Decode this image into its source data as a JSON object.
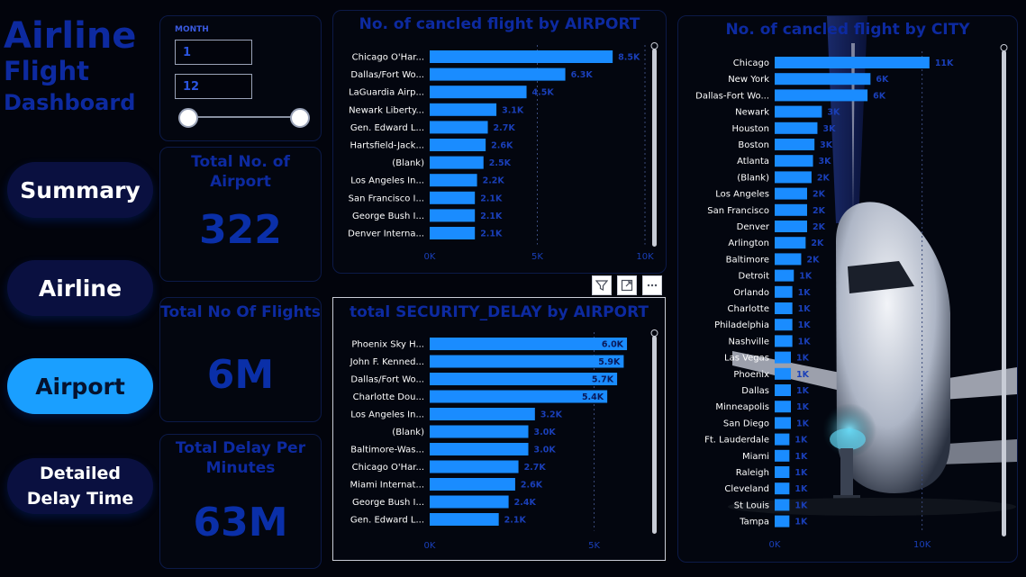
{
  "header": {
    "line1": "Airline",
    "line2": "Flight",
    "line3": "Dashboard"
  },
  "nav": {
    "summary": "Summary",
    "airline": "Airline",
    "airport": "Airport",
    "detailed": "Detailed Delay Time"
  },
  "filter": {
    "label": "MONTH",
    "min_value": "1",
    "max_value": "12"
  },
  "kpis": {
    "airports": {
      "title": "Total No. of Airport",
      "value": "322"
    },
    "flights": {
      "title": "Total No Of Flights",
      "value": "6M"
    },
    "delay": {
      "title": "Total Delay Per Minutes",
      "value": "63M"
    }
  },
  "colors": {
    "bar": "#1a8cff",
    "title": "#0d2aa0",
    "label": "#ffffff",
    "data_label": "#1a3fb8",
    "axis": "#1a3fb8"
  },
  "chart_data": [
    {
      "type": "bar",
      "orientation": "horizontal",
      "title": "No. of cancled flight by AIRPORT",
      "categories": [
        "Chicago O'Har...",
        "Dallas/Fort Wo...",
        "LaGuardia Airp...",
        "Newark Liberty...",
        "Gen. Edward L...",
        "Hartsfield-Jack...",
        "(Blank)",
        "Los Angeles In...",
        "San Francisco I...",
        "George Bush I...",
        "Denver Interna..."
      ],
      "values": [
        8500,
        6300,
        4500,
        3100,
        2700,
        2600,
        2500,
        2200,
        2100,
        2100,
        2100
      ],
      "data_labels": [
        "8.5K",
        "6.3K",
        "4.5K",
        "3.1K",
        "2.7K",
        "2.6K",
        "2.5K",
        "2.2K",
        "2.1K",
        "2.1K",
        "2.1K"
      ],
      "xticks": [
        "0K",
        "5K",
        "10K"
      ],
      "xlim": [
        0,
        10000
      ]
    },
    {
      "type": "bar",
      "orientation": "horizontal",
      "title": "total SECURITY_DELAY by AIRPORT",
      "categories": [
        "Phoenix Sky H...",
        "John F. Kenned...",
        "Dallas/Fort Wo...",
        "Charlotte Dou...",
        "Los Angeles In...",
        "(Blank)",
        "Baltimore-Was...",
        "Chicago O'Har...",
        "Miami Internat...",
        "George Bush I...",
        "Gen. Edward L..."
      ],
      "values": [
        6000,
        5900,
        5700,
        5400,
        3200,
        3000,
        3000,
        2700,
        2600,
        2400,
        2100
      ],
      "data_labels": [
        "6.0K",
        "5.9K",
        "5.7K",
        "5.4K",
        "3.2K",
        "3.0K",
        "3.0K",
        "2.7K",
        "2.6K",
        "2.4K",
        "2.1K"
      ],
      "xticks": [
        "0K",
        "5K"
      ],
      "xlim": [
        0,
        6300
      ]
    },
    {
      "type": "bar",
      "orientation": "horizontal",
      "title": "No. of cancled flight by CITY",
      "categories": [
        "Chicago",
        "New York",
        "Dallas-Fort Wo...",
        "Newark",
        "Houston",
        "Boston",
        "Atlanta",
        "(Blank)",
        "Los Angeles",
        "San Francisco",
        "Denver",
        "Arlington",
        "Baltimore",
        "Detroit",
        "Orlando",
        "Charlotte",
        "Philadelphia",
        "Nashville",
        "Las Vegas",
        "Phoenix",
        "Dallas",
        "Minneapolis",
        "San Diego",
        "Ft. Lauderdale",
        "Miami",
        "Raleigh",
        "Cleveland",
        "St Louis",
        "Tampa"
      ],
      "values": [
        10500,
        6500,
        6300,
        3200,
        2900,
        2700,
        2600,
        2500,
        2200,
        2200,
        2200,
        2100,
        1800,
        1300,
        1200,
        1200,
        1200,
        1200,
        1100,
        1100,
        1100,
        1100,
        1100,
        1000,
        1000,
        1000,
        1000,
        1000,
        1000
      ],
      "data_labels": [
        "11K",
        "6K",
        "6K",
        "3K",
        "3K",
        "3K",
        "3K",
        "2K",
        "2K",
        "2K",
        "2K",
        "2K",
        "2K",
        "1K",
        "1K",
        "1K",
        "1K",
        "1K",
        "1K",
        "1K",
        "1K",
        "1K",
        "1K",
        "1K",
        "1K",
        "1K",
        "1K",
        "1K",
        "1K"
      ],
      "xticks": [
        "0K",
        "10K"
      ],
      "xlim": [
        0,
        11000
      ]
    }
  ]
}
